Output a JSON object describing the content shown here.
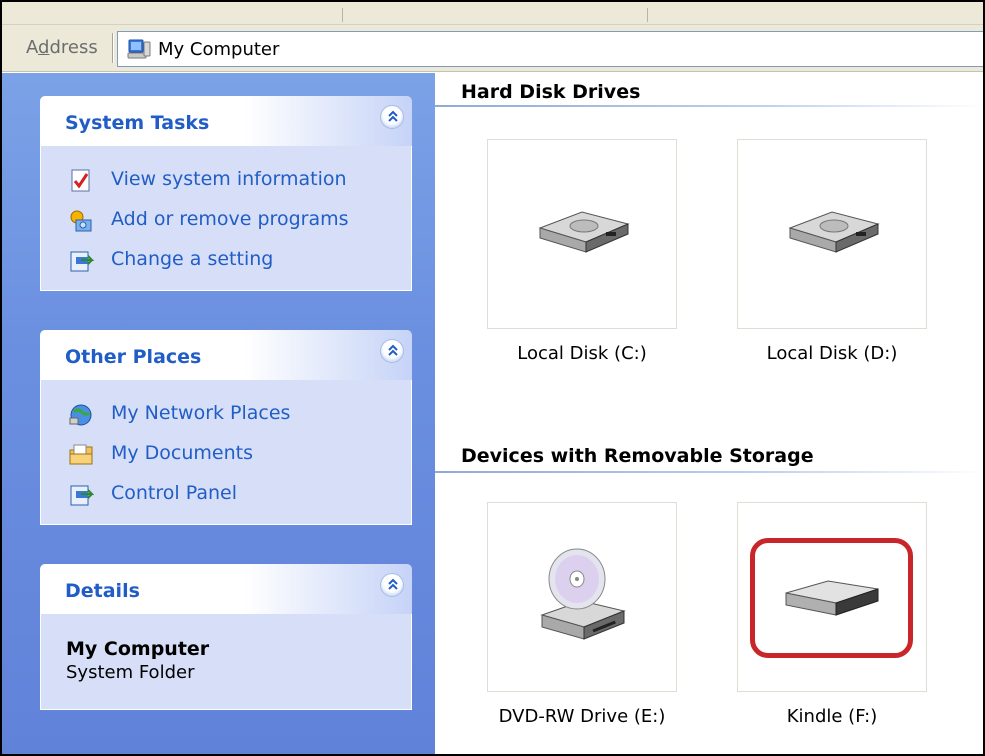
{
  "address_bar": {
    "label_prefix": "A",
    "label_accel": "d",
    "label_suffix": "dress",
    "value": "My Computer"
  },
  "task_pane": {
    "system_tasks": {
      "title": "System Tasks",
      "items": [
        {
          "label": "View system information",
          "icon": "system-info-icon"
        },
        {
          "label": "Add or remove programs",
          "icon": "add-remove-programs-icon"
        },
        {
          "label": "Change a setting",
          "icon": "control-panel-icon"
        }
      ]
    },
    "other_places": {
      "title": "Other Places",
      "items": [
        {
          "label": "My Network Places",
          "icon": "network-places-icon"
        },
        {
          "label": "My Documents",
          "icon": "my-documents-icon"
        },
        {
          "label": "Control Panel",
          "icon": "control-panel-icon"
        }
      ]
    },
    "details": {
      "title": "Details",
      "name": "My Computer",
      "type": "System Folder"
    }
  },
  "content": {
    "hard_disk_drives": {
      "title": "Hard Disk Drives",
      "drives": [
        {
          "label": "Local Disk (C:)",
          "icon": "hard-disk-icon"
        },
        {
          "label": "Local Disk (D:)",
          "icon": "hard-disk-icon"
        }
      ]
    },
    "removable_storage": {
      "title": "Devices with Removable Storage",
      "drives": [
        {
          "label": "DVD-RW Drive (E:)",
          "icon": "dvd-drive-icon"
        },
        {
          "label": "Kindle (F:)",
          "icon": "removable-drive-icon"
        }
      ]
    }
  },
  "colors": {
    "task_link": "#215dc6",
    "highlight": "#c8262a",
    "pane_blue": "#6b8fe0"
  }
}
